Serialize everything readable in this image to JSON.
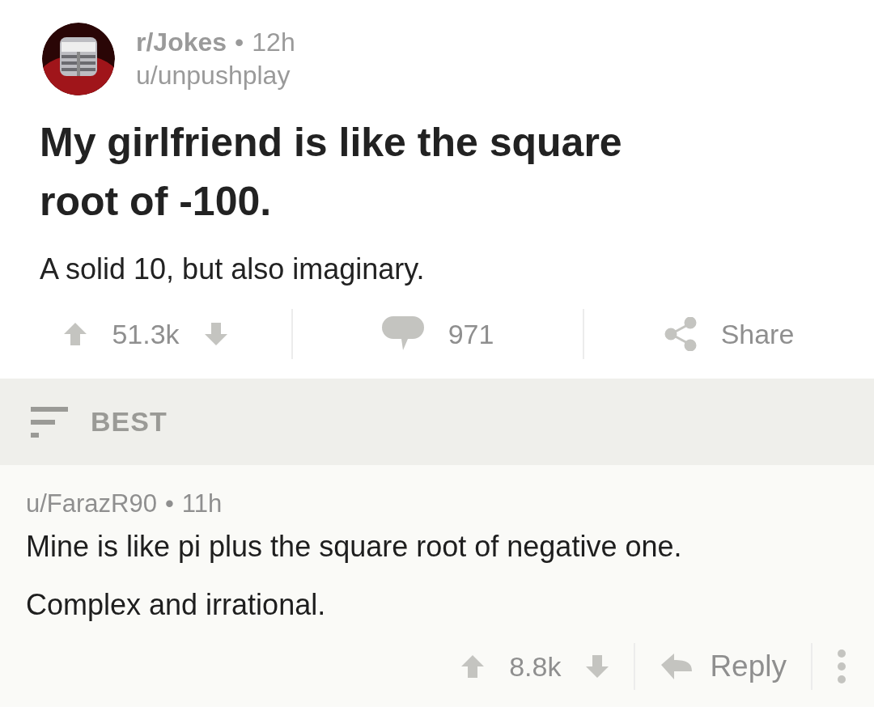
{
  "post": {
    "subreddit": "r/Jokes",
    "separator": "•",
    "age": "12h",
    "author": "u/unpushplay",
    "title": "My girlfriend is like the square root of -100.",
    "body": "A solid 10, but also imaginary.",
    "score": "51.3k",
    "comments": "971",
    "share": "Share"
  },
  "sort": {
    "label": "BEST"
  },
  "comment": {
    "author": "u/FarazR90",
    "separator": "•",
    "age": "11h",
    "paragraphs": [
      "Mine is like pi plus the square root of negative one.",
      "Complex and irrational."
    ],
    "score": "8.8k",
    "reply": "Reply"
  }
}
